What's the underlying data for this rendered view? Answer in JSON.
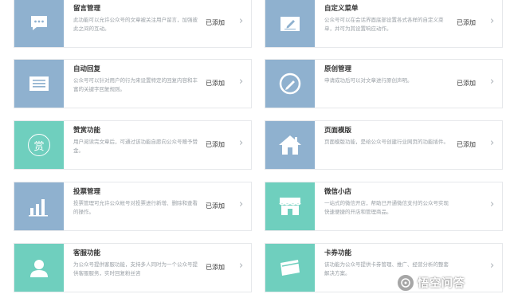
{
  "features": [
    {
      "title": "留言管理",
      "desc": "此功能可以允许公众号的文章被关注用户留言，加强彼此之间的互动。",
      "status": "已添加",
      "icon": "message-bubble-icon",
      "color": "#8fb1cf"
    },
    {
      "title": "自定义菜单",
      "desc": "公众号可以在会话界面底部设置各式各样的自定义菜单，并可为其设置响应动作。",
      "status": "已添加",
      "icon": "pencil-edit-icon",
      "color": "#8fb1cf"
    },
    {
      "title": "自动回复",
      "desc": "公众号可以针对用户的行为来设置特定的回复内容和丰富的关键字回复规则。",
      "status": "已添加",
      "icon": "reply-list-icon",
      "color": "#8fb1cf"
    },
    {
      "title": "原创管理",
      "desc": "申请成功后可以对文章进行原创声明。",
      "status": "已添加",
      "icon": "original-pen-icon",
      "color": "#8fb1cf"
    },
    {
      "title": "赞赏功能",
      "desc": "用户阅读完文章后，可通过该功能自愿向公众号赠予赞金。",
      "status": "已添加",
      "icon": "reward-coin-icon",
      "icon_text": "赏",
      "color": "#6fcfbe"
    },
    {
      "title": "页面模版",
      "desc": "页面模版功能，是给公众号创建行业网页的功能插件。",
      "status": "已添加",
      "icon": "home-template-icon",
      "color": "#8fb1cf"
    },
    {
      "title": "投票管理",
      "desc": "投票管理可允许公众帐号对投票进行新增、删除和查看的操作。",
      "status": "已添加",
      "icon": "bar-chart-icon",
      "color": "#8fb1cf"
    },
    {
      "title": "微信小店",
      "desc": "一站式的微信开店，帮助已开通微信支付的公众号实现快速便捷的开店和管理商品。",
      "status": "",
      "icon": "storefront-icon",
      "color": "#6fcfbe"
    },
    {
      "title": "客服功能",
      "desc": "为公众号提供客服功能，支持多人同时为一个公众号提供客服服务，实时回复粉丝咨",
      "status": "已添加",
      "icon": "customer-service-icon",
      "color": "#6fcfbe"
    },
    {
      "title": "卡券功能",
      "desc": "该功能为公众号提供卡券管理、推广、经营分析的整套解决方案。",
      "status": "",
      "icon": "coupon-card-icon",
      "color": "#6fcfbe"
    }
  ],
  "chevron": "›",
  "watermark": {
    "text": "悟空问答"
  }
}
